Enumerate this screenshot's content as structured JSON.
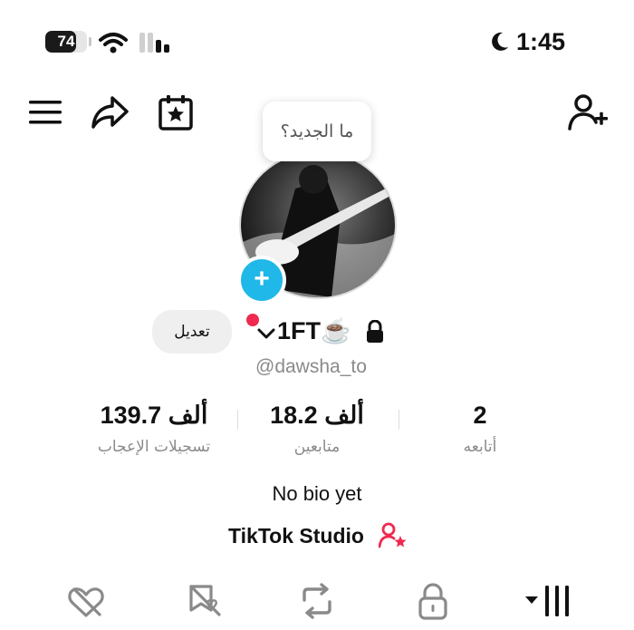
{
  "status_bar": {
    "battery_level": "74",
    "battery_fraction": 0.74,
    "time": "1:45"
  },
  "header_icons": [
    "menu-icon",
    "share-icon",
    "calendar-star-icon",
    "add-friend-icon"
  ],
  "profile": {
    "whats_new_bubble": "ما الجديد؟",
    "edit_button": "تعديل",
    "username": "1FT☕️",
    "handle": "@dawsha_to",
    "bio": "No bio yet",
    "studio_link": "TikTok Studio"
  },
  "stats": [
    {
      "value": "139.7 ألف",
      "label": "تسجيلات الإعجاب"
    },
    {
      "value": "18.2 ألف",
      "label": "متابعين"
    },
    {
      "value": "2",
      "label": "أتابعه"
    }
  ],
  "tabs": [
    {
      "icon": "liked-videos-icon"
    },
    {
      "icon": "favorites-icon"
    },
    {
      "icon": "reposts-icon"
    },
    {
      "icon": "private-lock-icon"
    },
    {
      "icon": "videos-grid-icon",
      "active": true
    }
  ],
  "colors": {
    "accent_blue": "#20b8e8",
    "notification_red": "#ef2950",
    "studio_pink": "#ef2950",
    "muted_text": "#8a8a8a"
  }
}
